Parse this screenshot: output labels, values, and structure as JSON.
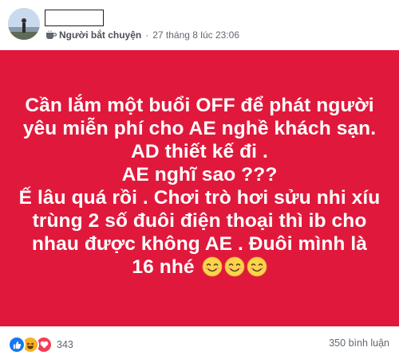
{
  "header": {
    "author_name": "",
    "role": "Người bắt chuyện",
    "separator": "·",
    "timestamp": "27 tháng 8 lúc 23:06",
    "role_icon": "coffee-cup-icon"
  },
  "post": {
    "background_color": "#e0193c",
    "lines": [
      "Cần lắm một buổi OFF để phát người",
      "yêu miễn phí cho AE nghề khách sạn.",
      "AD thiết kế đi .",
      "AE nghĩ sao ???",
      "Ế lâu quá rồi . Chơi trò hơi sửu nhi xíu",
      "trùng 2 số đuôi điện thoại thì ib cho",
      "nhau được không AE . Đuôi mình là",
      "16 nhé"
    ],
    "trailing_emoji": [
      "smiling-face-icon",
      "smiling-face-icon",
      "smiling-face-icon"
    ]
  },
  "footer": {
    "reaction_icons": [
      "like-icon",
      "haha-icon",
      "love-icon"
    ],
    "reaction_count": "343",
    "comment_count": "350 bình luận"
  }
}
